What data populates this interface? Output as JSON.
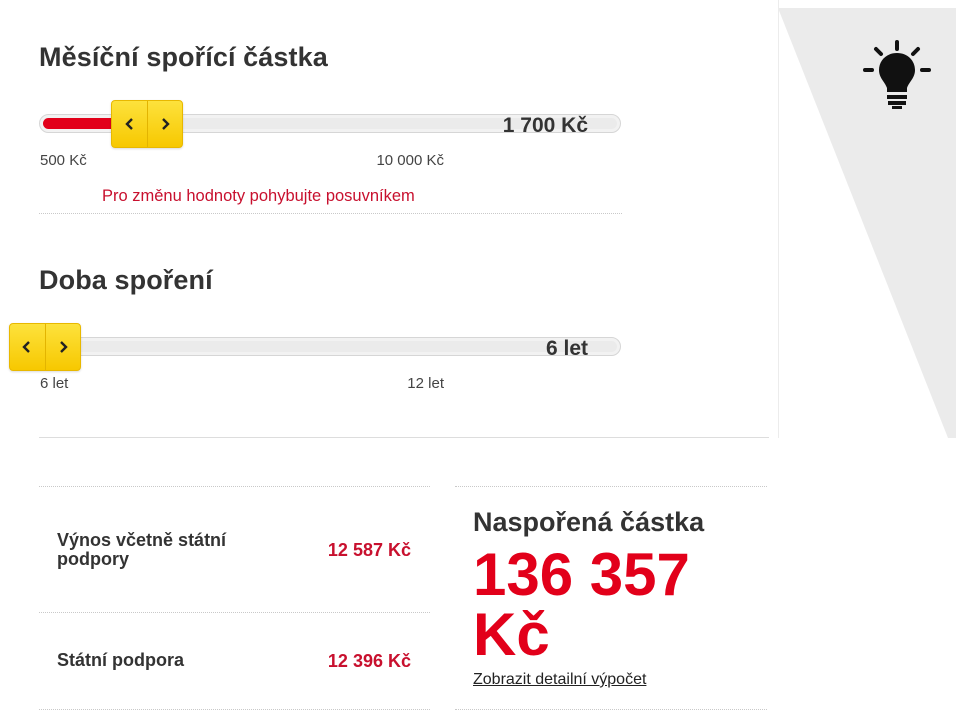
{
  "savings_amount": {
    "title": "Měsíční spořící částka",
    "value": "1 700 Kč",
    "min_label": "500 Kč",
    "max_label": "10 000 Kč",
    "hint": "Pro změnu hodnoty pohybujte posuvníkem",
    "fraction": 0.126
  },
  "savings_period": {
    "title": "Doba spoření",
    "value": "6 let",
    "min_label": "6 let",
    "max_label": "12 let",
    "fraction": 0
  },
  "results": {
    "yield_label": "Výnos včetně státní podpory",
    "yield_value": "12 587 Kč",
    "state_support_label": "Státní podpora",
    "state_support_value": "12 396 Kč",
    "total_title": "Naspořená částka",
    "total_value": "136 357 Kč",
    "detail_link": "Zobrazit detailní výpočet"
  },
  "icons": {
    "slider_left": "chevron-left-icon",
    "slider_right": "chevron-right-icon",
    "tip": "lightbulb-icon"
  },
  "colors": {
    "accent_red": "#e2001a",
    "handle_yellow": "#fcd93a"
  }
}
